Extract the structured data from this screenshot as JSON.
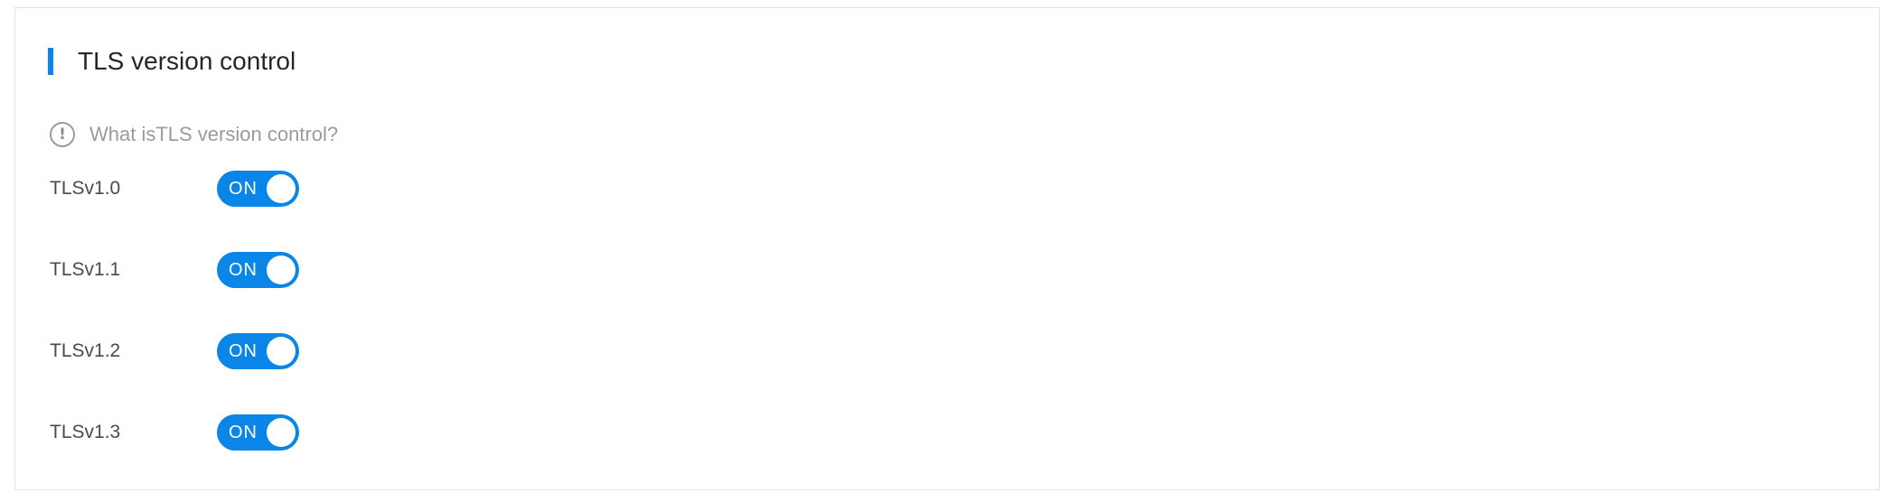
{
  "section": {
    "title": "TLS version control",
    "accent_color": "#0a86e8"
  },
  "help": {
    "icon": "exclamation-circle-icon",
    "text": "What isTLS version control?"
  },
  "tls_versions": [
    {
      "label": "TLSv1.0",
      "switch_text": "ON",
      "enabled": true
    },
    {
      "label": "TLSv1.1",
      "switch_text": "ON",
      "enabled": true
    },
    {
      "label": "TLSv1.2",
      "switch_text": "ON",
      "enabled": true
    },
    {
      "label": "TLSv1.3",
      "switch_text": "ON",
      "enabled": true
    }
  ]
}
